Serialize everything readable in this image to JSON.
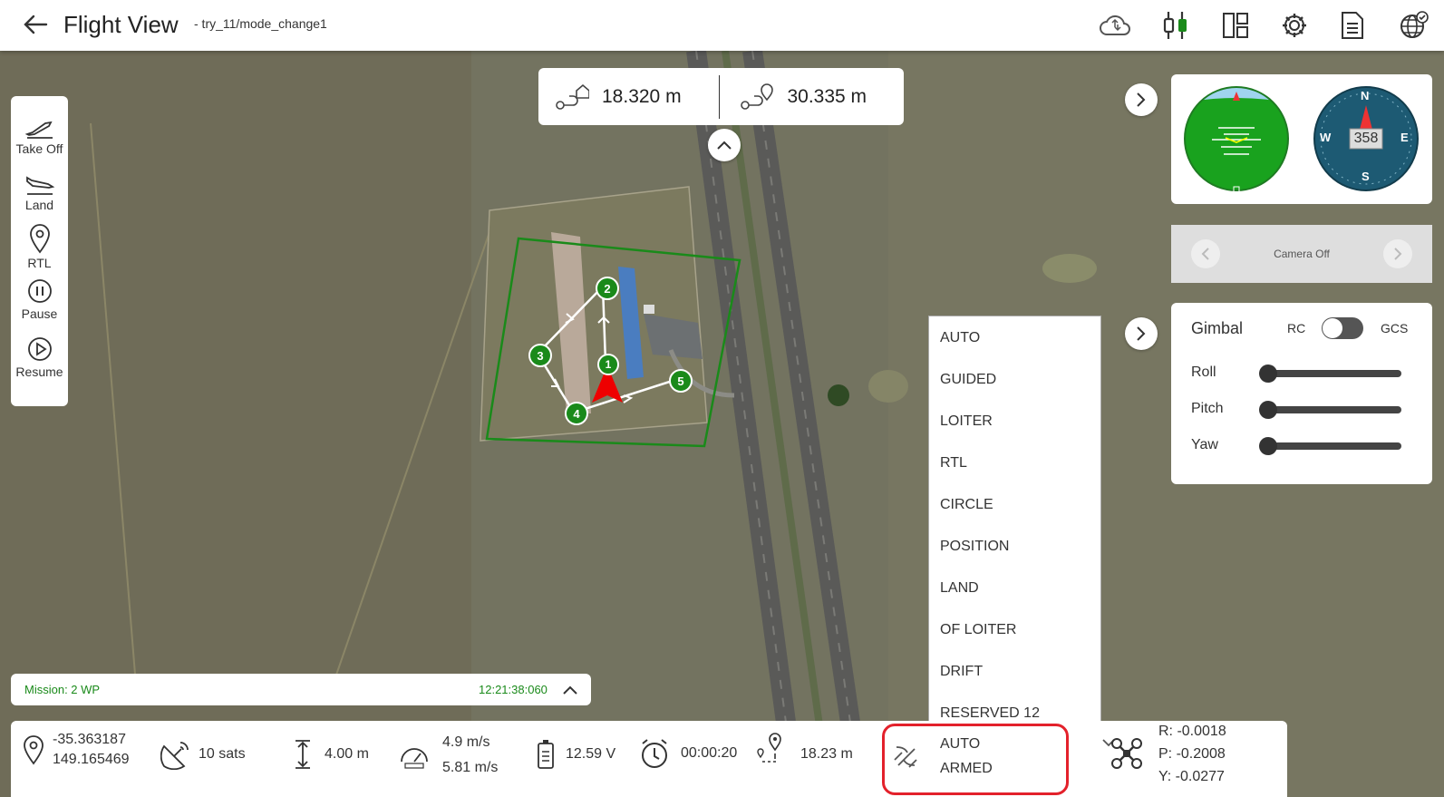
{
  "header": {
    "title": "Flight View",
    "subtitle": "- try_11/mode_change1",
    "icons": [
      "cloud-sync-icon",
      "connection-icon",
      "layout-icon",
      "settings-icon",
      "document-icon",
      "globe-check-icon"
    ]
  },
  "left_tools": [
    {
      "label": "Take Off",
      "icon": "takeoff-icon"
    },
    {
      "label": "Land",
      "icon": "land-icon"
    },
    {
      "label": "RTL",
      "icon": "rtl-icon"
    },
    {
      "label": "Pause",
      "icon": "pause-icon"
    },
    {
      "label": "Resume",
      "icon": "resume-icon"
    }
  ],
  "distances": {
    "home": "18.320 m",
    "waypoint": "30.335 m"
  },
  "map": {
    "waypoints": [
      "1",
      "2",
      "3",
      "4",
      "5"
    ]
  },
  "instruments": {
    "compass_heading": "358",
    "compass_labels": {
      "n": "N",
      "e": "E",
      "s": "S",
      "w": "W"
    }
  },
  "camera": {
    "label": "Camera Off"
  },
  "gimbal": {
    "title": "Gimbal",
    "rc": "RC",
    "gcs": "GCS",
    "sliders": [
      {
        "label": "Roll",
        "value": 0
      },
      {
        "label": "Pitch",
        "value": 0
      },
      {
        "label": "Yaw",
        "value": 0
      }
    ]
  },
  "mode_options": [
    "AUTO",
    "GUIDED",
    "LOITER",
    "RTL",
    "CIRCLE",
    "POSITION",
    "LAND",
    "OF LOITER",
    "DRIFT",
    "RESERVED 12"
  ],
  "mission": {
    "label": "Mission: 2 WP",
    "time": "12:21:38:060"
  },
  "status": {
    "lat": "-35.363187",
    "lon": "149.165469",
    "sats": "10 sats",
    "altitude": "4.00 m",
    "speed1": "4.9 m/s",
    "speed2": "5.81 m/s",
    "voltage": "12.59 V",
    "timer": "00:00:20",
    "distance": "18.23 m",
    "mode": "AUTO",
    "armed": "ARMED",
    "r": "R: -0.0018",
    "p": "P: -0.2008",
    "y": "Y: -0.0277"
  },
  "colors": {
    "accent": "#1a8a1a",
    "highlight": "#e3212b",
    "fence": "#1a8a1a"
  }
}
